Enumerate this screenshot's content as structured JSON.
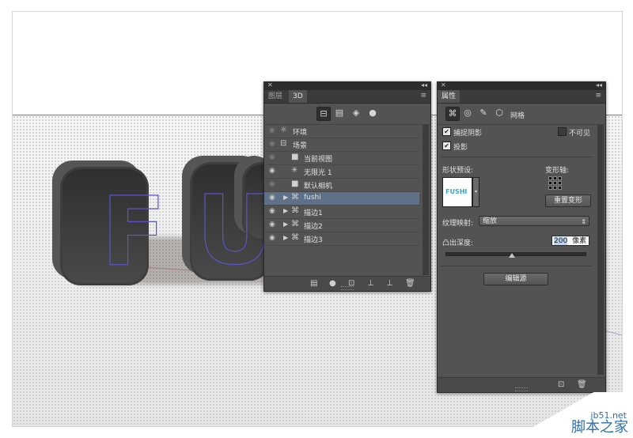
{
  "scene": {
    "letters": [
      "F",
      "U"
    ],
    "colors": {
      "letter": "#3a3a3a",
      "stroke": "#5a55c8",
      "floor": "#eeeeee"
    }
  },
  "layers_panel": {
    "tabs": [
      {
        "label": "图层",
        "active": false
      },
      {
        "label": "3D",
        "active": true
      }
    ],
    "filter_icons": [
      "scene-filter-icon",
      "mesh-filter-icon",
      "material-filter-icon",
      "light-filter-icon"
    ],
    "rows": [
      {
        "label": "环境",
        "icon": "environment-icon",
        "eye": "dim",
        "indent": 0,
        "expand": false,
        "selected": false
      },
      {
        "label": "场景",
        "icon": "scene-icon",
        "eye": "dim",
        "indent": 0,
        "expand": false,
        "selected": false
      },
      {
        "label": "当前视图",
        "icon": "camera-icon",
        "eye": "dim",
        "indent": 1,
        "expand": false,
        "selected": false
      },
      {
        "label": "无限光 1",
        "icon": "infinite-light-icon",
        "eye": "on",
        "indent": 1,
        "expand": false,
        "selected": false
      },
      {
        "label": "默认相机",
        "icon": "camera-icon",
        "eye": "dim",
        "indent": 1,
        "expand": false,
        "selected": false
      },
      {
        "label": "fushi",
        "icon": "mesh-icon",
        "eye": "on",
        "indent": 1,
        "expand": true,
        "selected": true
      },
      {
        "label": "描边1",
        "icon": "mesh-icon",
        "eye": "on",
        "indent": 1,
        "expand": true,
        "selected": false
      },
      {
        "label": "描边2",
        "icon": "mesh-icon",
        "eye": "on",
        "indent": 1,
        "expand": true,
        "selected": false
      },
      {
        "label": "描边3",
        "icon": "mesh-icon",
        "eye": "on",
        "indent": 1,
        "expand": true,
        "selected": false
      }
    ],
    "bottom_icons": [
      "new-scene-icon",
      "add-light-icon",
      "render-icon",
      "ground-icon",
      "new-object-icon",
      "delete-icon"
    ]
  },
  "properties_panel": {
    "tab": "属性",
    "toolbar": {
      "mesh_label": "网格"
    },
    "catch_shadows": {
      "label": "捕捉阴影",
      "checked": true
    },
    "invisible": {
      "label": "不可见",
      "checked": false
    },
    "cast_shadows": {
      "label": "投影",
      "checked": true
    },
    "shape_preset_label": "形状预设:",
    "preset_text": "FUSHI",
    "deform_axis_label": "变形轴:",
    "reset_deform_label": "重置变形",
    "texture_mapping_label": "纹理映射:",
    "texture_mapping_value": "缩放",
    "extrusion_depth_label": "凸出深度:",
    "extrusion_depth_value": "200",
    "extrusion_depth_unit": "像素",
    "extrusion_slider_fraction": 0.48,
    "edit_source_label": "编辑源"
  },
  "watermark": {
    "url": "jb51.net",
    "name": "脚本之家"
  }
}
